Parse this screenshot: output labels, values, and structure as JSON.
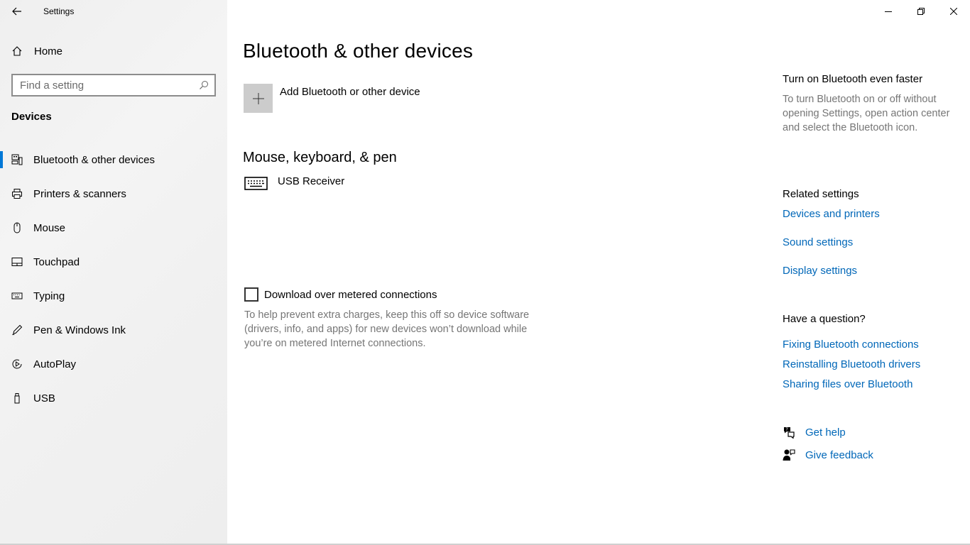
{
  "window": {
    "app_title": "Settings",
    "controls": [
      "minimize-icon",
      "restore-icon",
      "close-icon"
    ]
  },
  "sidebar": {
    "home_label": "Home",
    "search_placeholder": "Find a setting",
    "section_title": "Devices",
    "items": [
      {
        "label": "Bluetooth & other devices",
        "icon": "bluetooth-devices-icon",
        "selected": true
      },
      {
        "label": "Printers & scanners",
        "icon": "printer-icon",
        "selected": false
      },
      {
        "label": "Mouse",
        "icon": "mouse-icon",
        "selected": false
      },
      {
        "label": "Touchpad",
        "icon": "touchpad-icon",
        "selected": false
      },
      {
        "label": "Typing",
        "icon": "keyboard-icon",
        "selected": false
      },
      {
        "label": "Pen & Windows Ink",
        "icon": "pen-icon",
        "selected": false
      },
      {
        "label": "AutoPlay",
        "icon": "autoplay-icon",
        "selected": false
      },
      {
        "label": "USB",
        "icon": "usb-icon",
        "selected": false
      }
    ]
  },
  "main": {
    "title": "Bluetooth & other devices",
    "add_device_label": "Add Bluetooth or other device",
    "section_title": "Mouse, keyboard, & pen",
    "device_name": "USB Receiver",
    "metered_checkbox_label": "Download over metered connections",
    "metered_checked": false,
    "metered_help": "To help prevent extra charges, keep this off so device software (drivers, info, and apps) for new devices won’t download while you’re on metered Internet connections."
  },
  "right": {
    "tip_heading": "Turn on Bluetooth even faster",
    "tip_text": "To turn Bluetooth on or off without opening Settings, open action center and select the Bluetooth icon.",
    "related_heading": "Related settings",
    "related_links": [
      "Devices and printers",
      "Sound settings",
      "Display settings"
    ],
    "question_heading": "Have a question?",
    "question_links": [
      "Fixing Bluetooth connections",
      "Reinstalling Bluetooth drivers",
      "Sharing files over Bluetooth"
    ],
    "get_help": "Get help",
    "give_feedback": "Give feedback"
  },
  "colors": {
    "accent": "#0078d7",
    "link": "#0067b8",
    "secondary_text": "#767676"
  }
}
